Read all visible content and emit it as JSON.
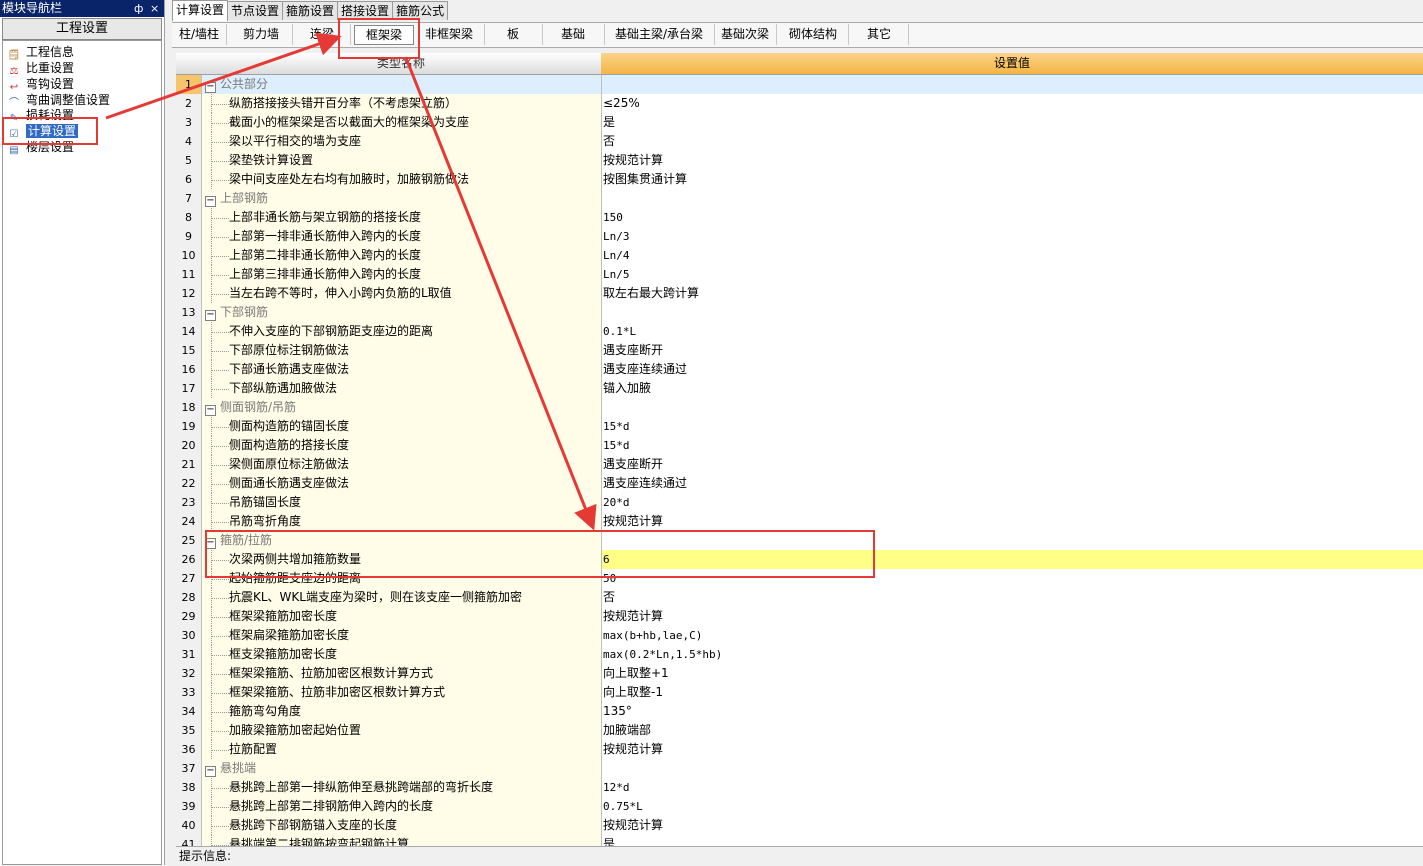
{
  "nav": {
    "title": "模块导航栏",
    "pin": "ф",
    "close": "×",
    "header": "工程设置",
    "items": [
      {
        "label": "工程信息",
        "icon": "info-icon"
      },
      {
        "label": "比重设置",
        "icon": "weight-icon"
      },
      {
        "label": "弯钩设置",
        "icon": "hook-icon"
      },
      {
        "label": "弯曲调整值设置",
        "icon": "bend-icon"
      },
      {
        "label": "损耗设置",
        "icon": "loss-icon"
      },
      {
        "label": "计算设置",
        "icon": "calc-settings-icon"
      },
      {
        "label": "楼层设置",
        "icon": "floor-icon"
      }
    ]
  },
  "tabs": [
    "计算设置",
    "节点设置",
    "箍筋设置",
    "搭接设置",
    "箍筋公式"
  ],
  "subtabs": [
    "柱/墙柱",
    "剪力墙",
    "连梁",
    "框架梁",
    "非框架梁",
    "板",
    "基础",
    "基础主梁/承台梁",
    "基础次梁",
    "砌体结构",
    "其它"
  ],
  "grid": {
    "col_name": "类型名称",
    "col_value": "设置值",
    "rows": [
      {
        "n": "1",
        "name": "公共部分",
        "val": "",
        "group": true
      },
      {
        "n": "2",
        "name": "纵筋搭接接头错开百分率（不考虑架立筋）",
        "val": "≤25%"
      },
      {
        "n": "3",
        "name": "截面小的框架梁是否以截面大的框架梁为支座",
        "val": "是"
      },
      {
        "n": "4",
        "name": "梁以平行相交的墙为支座",
        "val": "否"
      },
      {
        "n": "5",
        "name": "梁垫铁计算设置",
        "val": "按规范计算"
      },
      {
        "n": "6",
        "name": "梁中间支座处左右均有加腋时，加腋钢筋做法",
        "val": "按图集贯通计算"
      },
      {
        "n": "7",
        "name": "上部钢筋",
        "val": "",
        "group": true
      },
      {
        "n": "8",
        "name": "上部非通长筋与架立钢筋的搭接长度",
        "val": "150"
      },
      {
        "n": "9",
        "name": "上部第一排非通长筋伸入跨内的长度",
        "val": "Ln/3"
      },
      {
        "n": "10",
        "name": "上部第二排非通长筋伸入跨内的长度",
        "val": "Ln/4"
      },
      {
        "n": "11",
        "name": "上部第三排非通长筋伸入跨内的长度",
        "val": "Ln/5"
      },
      {
        "n": "12",
        "name": "当左右跨不等时，伸入小跨内负筋的L取值",
        "val": "取左右最大跨计算"
      },
      {
        "n": "13",
        "name": "下部钢筋",
        "val": "",
        "group": true
      },
      {
        "n": "14",
        "name": "不伸入支座的下部钢筋距支座边的距离",
        "val": "0.1*L"
      },
      {
        "n": "15",
        "name": "下部原位标注钢筋做法",
        "val": "遇支座断开"
      },
      {
        "n": "16",
        "name": "下部通长筋遇支座做法",
        "val": "遇支座连续通过"
      },
      {
        "n": "17",
        "name": "下部纵筋遇加腋做法",
        "val": "锚入加腋"
      },
      {
        "n": "18",
        "name": "侧面钢筋/吊筋",
        "val": "",
        "group": true
      },
      {
        "n": "19",
        "name": "侧面构造筋的锚固长度",
        "val": "15*d"
      },
      {
        "n": "20",
        "name": "侧面构造筋的搭接长度",
        "val": "15*d"
      },
      {
        "n": "21",
        "name": "梁侧面原位标注筋做法",
        "val": "遇支座断开"
      },
      {
        "n": "22",
        "name": "侧面通长筋遇支座做法",
        "val": "遇支座连续通过"
      },
      {
        "n": "23",
        "name": "吊筋锚固长度",
        "val": "20*d"
      },
      {
        "n": "24",
        "name": "吊筋弯折角度",
        "val": "按规范计算"
      },
      {
        "n": "25",
        "name": "箍筋/拉筋",
        "val": "",
        "group": true
      },
      {
        "n": "26",
        "name": "次梁两侧共增加箍筋数量",
        "val": "6",
        "hl": true
      },
      {
        "n": "27",
        "name": "起始箍筋距支座边的距离",
        "val": "50"
      },
      {
        "n": "28",
        "name": "抗震KL、WKL端支座为梁时，则在该支座一侧箍筋加密",
        "val": "否"
      },
      {
        "n": "29",
        "name": "框架梁箍筋加密长度",
        "val": "按规范计算"
      },
      {
        "n": "30",
        "name": "框架扁梁箍筋加密长度",
        "val": "max(b+hb,lae,C)"
      },
      {
        "n": "31",
        "name": "框支梁箍筋加密长度",
        "val": "max(0.2*Ln,1.5*hb)"
      },
      {
        "n": "32",
        "name": "框架梁箍筋、拉筋加密区根数计算方式",
        "val": "向上取整+1"
      },
      {
        "n": "33",
        "name": "框架梁箍筋、拉筋非加密区根数计算方式",
        "val": "向上取整-1"
      },
      {
        "n": "34",
        "name": "箍筋弯勾角度",
        "val": "135°"
      },
      {
        "n": "35",
        "name": "加腋梁箍筋加密起始位置",
        "val": "加腋端部"
      },
      {
        "n": "36",
        "name": "拉筋配置",
        "val": "按规范计算"
      },
      {
        "n": "37",
        "name": "悬挑端",
        "val": "",
        "group": true
      },
      {
        "n": "38",
        "name": "悬挑跨上部第一排纵筋伸至悬挑跨端部的弯折长度",
        "val": "12*d"
      },
      {
        "n": "39",
        "name": "悬挑跨上部第二排钢筋伸入跨内的长度",
        "val": "0.75*L"
      },
      {
        "n": "40",
        "name": "悬挑跨下部钢筋锚入支座的长度",
        "val": "按规范计算"
      },
      {
        "n": "41",
        "name": "悬挑端第二排钢筋按弯起钢筋计算",
        "val": "是"
      }
    ]
  },
  "status": {
    "label": "提示信息:"
  },
  "colors": {
    "annotation": "#e53935",
    "highlight": "#ffff88",
    "header_value": "#f4b545"
  }
}
